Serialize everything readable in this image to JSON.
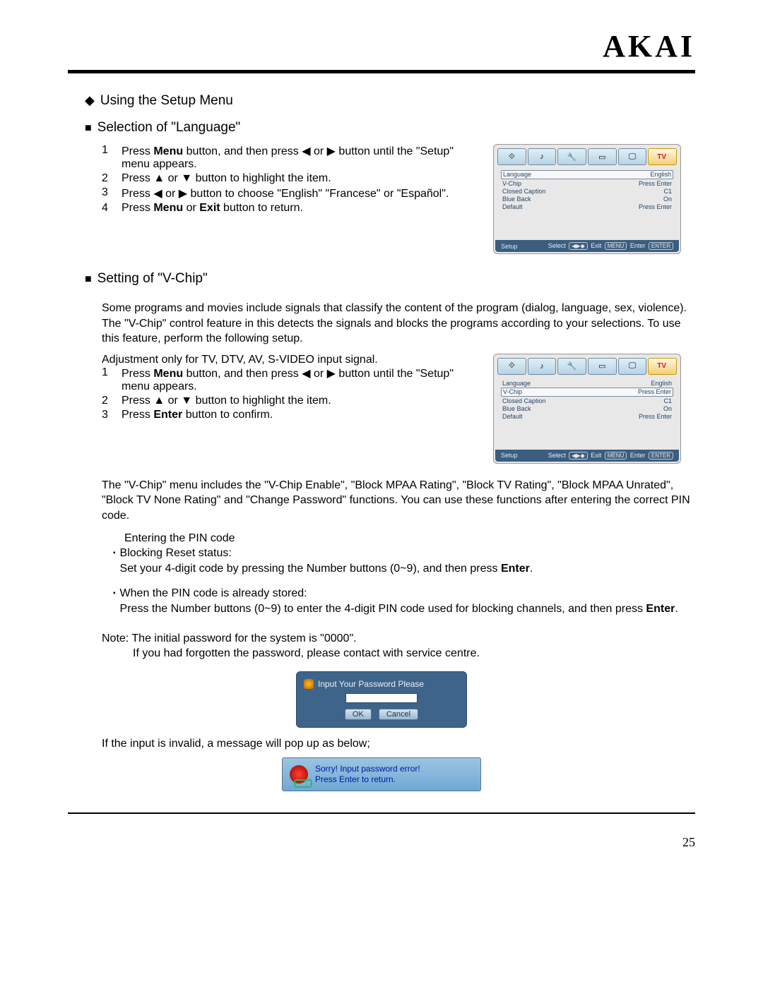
{
  "brand": "AKAI",
  "page_number": "25",
  "section_title": "Using the Setup Menu",
  "language_section": {
    "title": "Selection of \"Language\"",
    "steps": [
      {
        "n": "1",
        "t1": "Press ",
        "b1": "Menu",
        "t2": " button, and then press ◀ or ▶ button until the \"Setup\" menu appears."
      },
      {
        "n": "2",
        "t1": "Press ▲ or ▼ button to highlight the item."
      },
      {
        "n": "3",
        "t1": "Press ◀ or ▶ button to choose \"English\" \"Francese\" or \"Español\"."
      },
      {
        "n": "4",
        "t1": "Press ",
        "b1": "Menu",
        "t2": " or ",
        "b2": "Exit",
        "t3": " button to return."
      }
    ]
  },
  "osd1": {
    "title": "Setup",
    "tabs_tv": "TV",
    "rows": [
      {
        "l": "Language",
        "r": "English",
        "sel": true
      },
      {
        "l": "V-Chip",
        "r": "Press Enter"
      },
      {
        "l": "Closed Caption",
        "r": "C1"
      },
      {
        "l": "Blue Back",
        "r": "On"
      },
      {
        "l": "Default",
        "r": "Press Enter"
      }
    ],
    "foot_select": "Select",
    "foot_nav": "◀▶◆",
    "foot_exit": "Exit",
    "foot_menu": "MENU",
    "foot_enter": "Enter",
    "foot_enterbtn": "ENTER"
  },
  "vchip_section": {
    "title": "Setting of \"V-Chip\"",
    "intro": "Some programs and movies include signals that classify the content of the program (dialog, language, sex, violence). The \"V-Chip\" control feature in this detects the signals and blocks the programs according to your selections. To use this feature, perform the following setup.",
    "adjust": "Adjustment only for TV, DTV, AV, S-VIDEO input signal.",
    "steps": [
      {
        "n": "1",
        "t1": "Press ",
        "b1": "Menu",
        "t2": " button, and then press ◀ or ▶ button until the \"Setup\" menu appears."
      },
      {
        "n": "2",
        "t1": "Press ▲ or ▼ button to highlight the item."
      },
      {
        "n": "3",
        "t1": "Press ",
        "b1": "Enter",
        "t2": " button to confirm."
      }
    ],
    "desc2": "The \"V-Chip\" menu includes the \"V-Chip Enable\", \"Block MPAA Rating\", \"Block TV Rating\", \"Block MPAA Unrated\", \"Block TV None Rating\" and \"Change Password\" functions. You can use these functions after entering the correct PIN code.",
    "pin_title": "Entering the PIN code",
    "bullet1_title": "Blocking Reset status:",
    "bullet1_body_a": "Set your 4-digit code by pressing the Number buttons (0~9), and then press ",
    "bullet1_body_b": "Enter",
    "bullet1_body_c": ".",
    "bullet2_title": "When the PIN code is already stored:",
    "bullet2_body_a": "Press the Number buttons (0~9) to enter the 4-digit PIN code used for blocking channels, and then press ",
    "bullet2_body_b": "Enter",
    "bullet2_body_c": ".",
    "note_l1": "Note: The initial password for the system is \"0000\".",
    "note_l2": "If you had forgotten the password, please contact with service centre."
  },
  "osd2": {
    "title": "Setup",
    "rows": [
      {
        "l": "Language",
        "r": "English"
      },
      {
        "l": "V-Chip",
        "r": "Press Enter",
        "sel": true
      },
      {
        "l": "Closed Caption",
        "r": "C1"
      },
      {
        "l": "Blue Back",
        "r": "On"
      },
      {
        "l": "Default",
        "r": "Press Enter"
      }
    ]
  },
  "dlg": {
    "title": "Input Your Password Please",
    "ok": "OK",
    "cancel": "Cancel"
  },
  "invalid_line": "If the input is invalid, a message will pop up as below;",
  "err": {
    "l1": "Sorry! Input password error!",
    "l2": "Press Enter to return."
  }
}
